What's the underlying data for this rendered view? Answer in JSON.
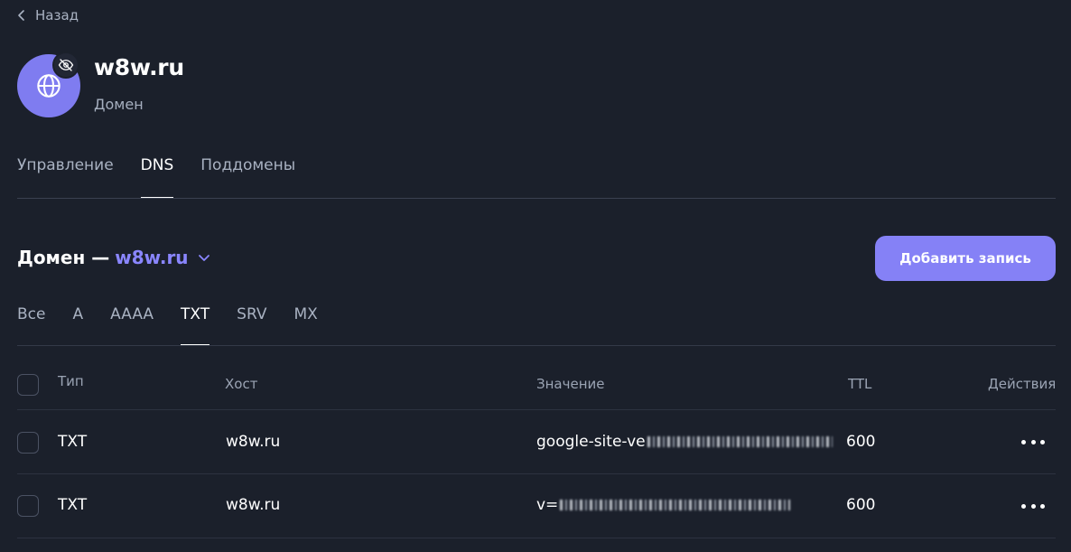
{
  "nav": {
    "back_label": "Назад"
  },
  "header": {
    "title": "w8w.ru",
    "subtitle": "Домен"
  },
  "main_tabs": [
    {
      "label": "Управление",
      "active": false
    },
    {
      "label": "DNS",
      "active": true
    },
    {
      "label": "Поддомены",
      "active": false
    }
  ],
  "section": {
    "prefix": "Домен —",
    "domain": "w8w.ru"
  },
  "actions": {
    "add_record_label": "Добавить запись"
  },
  "filter_tabs": [
    {
      "label": "Все",
      "active": false
    },
    {
      "label": "A",
      "active": false
    },
    {
      "label": "AAAA",
      "active": false
    },
    {
      "label": "TXT",
      "active": true
    },
    {
      "label": "SRV",
      "active": false
    },
    {
      "label": "MX",
      "active": false
    }
  ],
  "table": {
    "headers": {
      "type": "Тип",
      "host": "Хост",
      "value": "Значение",
      "ttl": "TTL",
      "actions": "Действия"
    },
    "rows": [
      {
        "type": "TXT",
        "host": "w8w.ru",
        "value": "google-site-ve",
        "ttl": "600"
      },
      {
        "type": "TXT",
        "host": "w8w.ru",
        "value": "v=",
        "ttl": "600"
      }
    ]
  },
  "colors": {
    "background": "#1b202b",
    "accent": "#8581f6",
    "avatar": "#7f7cf0"
  },
  "icons": {
    "back": "chevron-left-icon",
    "avatar": "globe-icon",
    "badge": "eye-off-icon",
    "dropdown": "chevron-down-icon",
    "row_menu": "more-horizontal-icon"
  }
}
